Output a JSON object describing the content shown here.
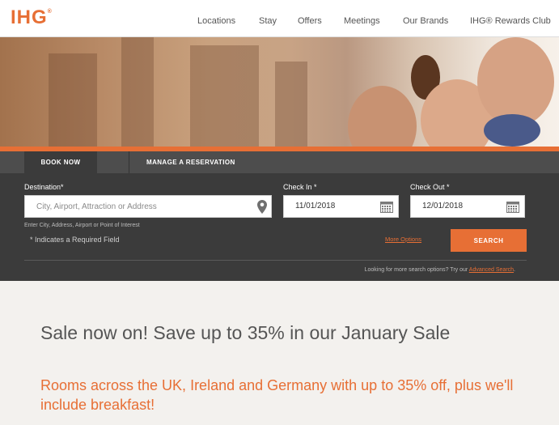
{
  "header": {
    "logo_text": "IHG",
    "logo_mark": "®",
    "nav": [
      {
        "label": "Locations"
      },
      {
        "label": "Stay"
      },
      {
        "label": "Offers"
      },
      {
        "label": "Meetings"
      },
      {
        "label": "Our Brands"
      },
      {
        "label": "IHG® Rewards Club"
      }
    ]
  },
  "booking": {
    "tabs": {
      "book_now": "BOOK NOW",
      "manage": "MANAGE A RESERVATION"
    },
    "destination": {
      "label": "Destination*",
      "placeholder": "City, Airport, Attraction or Address",
      "value": "",
      "hint": "Enter City, Address, Airport or Point of Interest"
    },
    "check_in": {
      "label": "Check In *",
      "value": "11/01/2018"
    },
    "check_out": {
      "label": "Check Out *",
      "value": "12/01/2018"
    },
    "required_note": "* Indicates a Required Field",
    "more_options": "More Options",
    "search_button": "SEARCH",
    "advanced_prefix": "Looking for more search options? Try our",
    "advanced_link": "Advanced Search",
    "advanced_suffix": "."
  },
  "content": {
    "title": "Sale now on! Save up to 35% in our January Sale",
    "subtitle": "Rooms across the UK, Ireland and Germany with up to 35% off, plus we'll include breakfast!"
  },
  "colors": {
    "accent": "#e76f35",
    "panel": "#3b3b3b",
    "page_bg": "#f3f1ee"
  },
  "icons": {
    "destination": "location-pin-icon",
    "check_in": "calendar-icon",
    "check_out": "calendar-icon"
  }
}
